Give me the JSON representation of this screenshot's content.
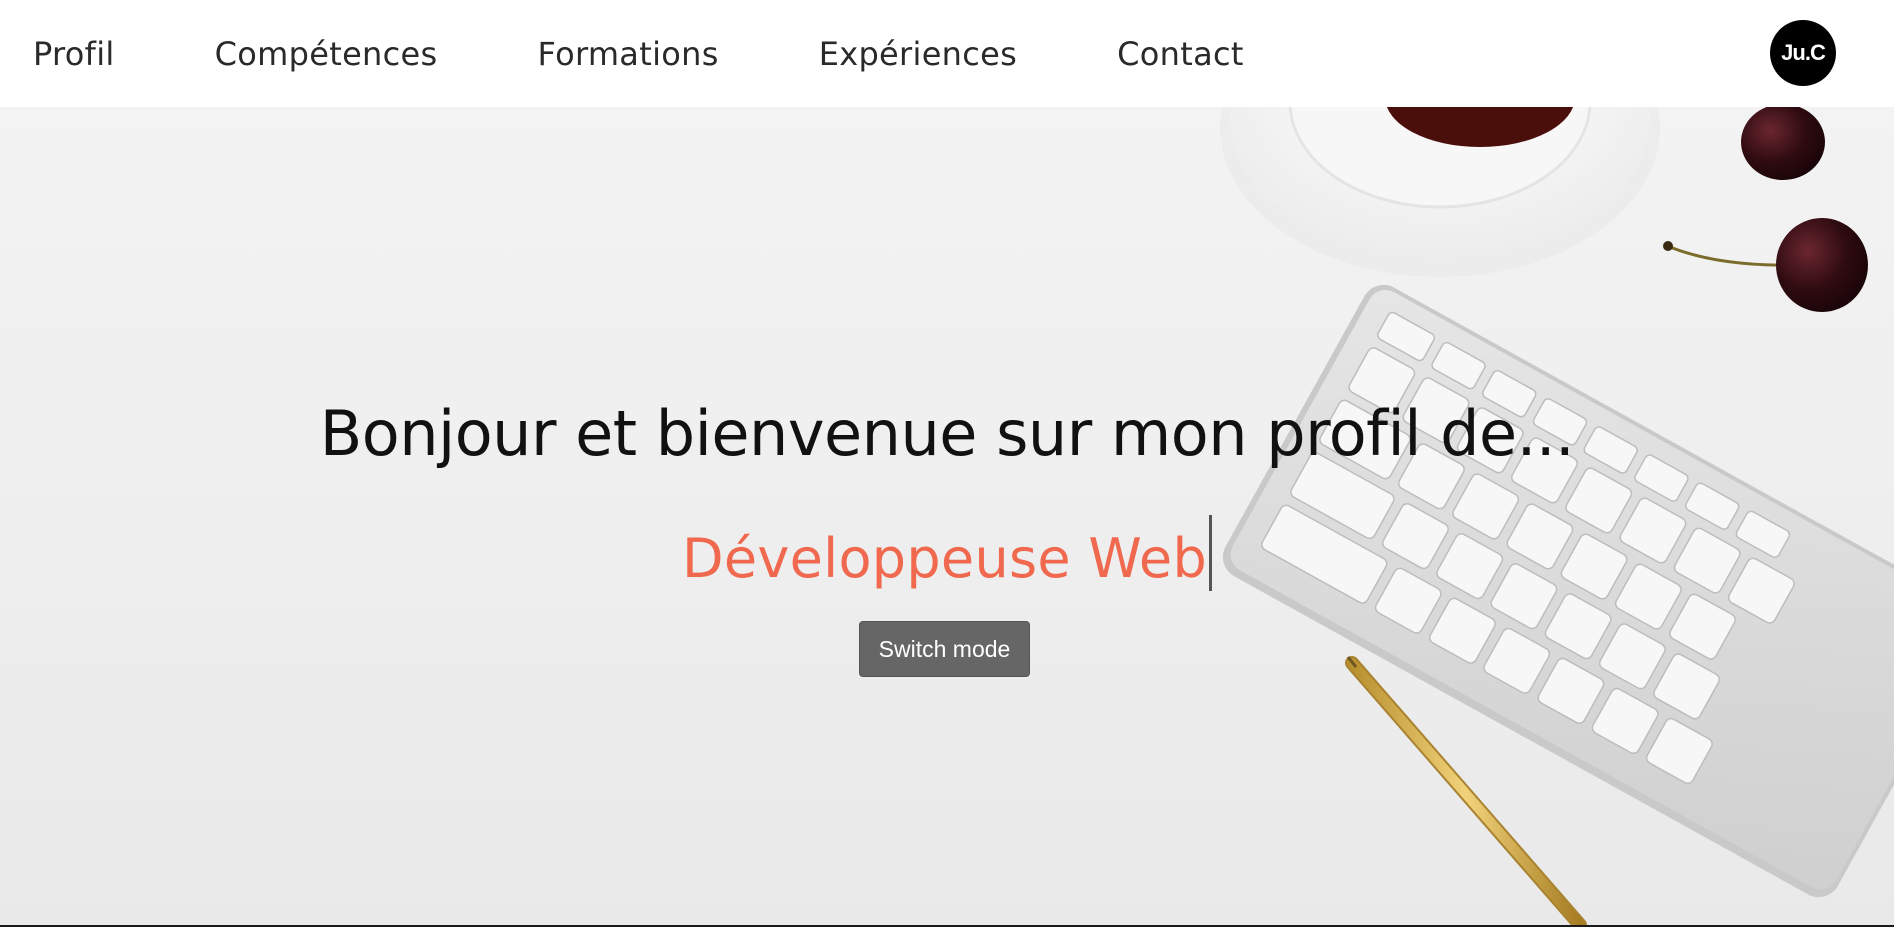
{
  "nav": {
    "items": [
      {
        "label": "Profil"
      },
      {
        "label": "Compétences"
      },
      {
        "label": "Formations"
      },
      {
        "label": "Expériences"
      },
      {
        "label": "Contact"
      }
    ],
    "logo_text": "Ju.C"
  },
  "hero": {
    "title": "Bonjour et bienvenue sur mon profil de...",
    "subtitle": "Développeuse Web",
    "switch_label": "Switch mode",
    "background_image": "desk-keyboard-coffee-cherries-pen"
  },
  "colors": {
    "accent": "#f0694f",
    "logo_bg": "#000000",
    "button_bg": "#666666",
    "nav_bg": "#ffffff"
  }
}
